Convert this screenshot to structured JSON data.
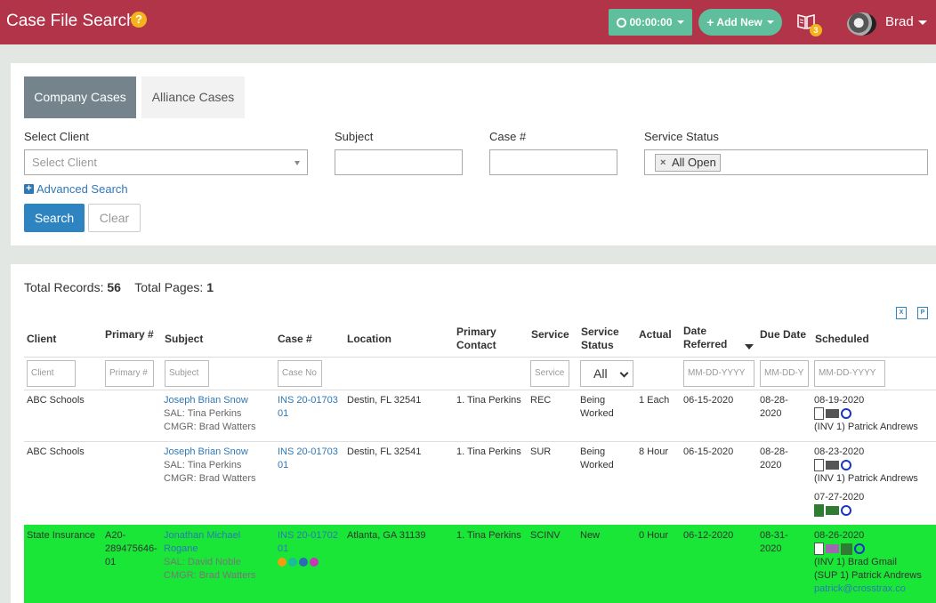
{
  "header": {
    "title": "Case File Search",
    "help": "?",
    "timer_label": "00:00:00",
    "add_new_label": "Add New",
    "notif_count": "3",
    "user_name": "Brad",
    "color": "#b13449"
  },
  "tabs": [
    {
      "label": "Company Cases",
      "active": true
    },
    {
      "label": "Alliance Cases",
      "active": false
    }
  ],
  "filters": {
    "client_label": "Select Client",
    "client_placeholder": "Select Client",
    "subject_label": "Subject",
    "subject_value": "",
    "case_label": "Case #",
    "case_value": "",
    "status_label": "Service Status",
    "status_tag": "All Open",
    "advanced": "Advanced Search",
    "search_btn": "Search",
    "clear_btn": "Clear"
  },
  "results": {
    "total_records_label": "Total Records:",
    "total_records": "56",
    "total_pages_label": "Total Pages:",
    "total_pages": "1"
  },
  "table": {
    "headers": {
      "client": "Client",
      "primary": "Primary #",
      "subject": "Subject",
      "case": "Case #",
      "location": "Location",
      "contact1": "Primary",
      "contact2": "Contact",
      "service": "Service",
      "status1": "Service",
      "status2": "Status",
      "actual": "Actual",
      "referred1": "Date",
      "referred2": "Referred",
      "due": "Due Date",
      "scheduled": "Scheduled"
    },
    "filter_placeholders": {
      "client": "Client",
      "primary": "Primary #",
      "subject": "Subject",
      "case": "Case No",
      "service": "Service",
      "status": "All",
      "referred": "MM-DD-YYYY",
      "due": "MM-DD-Y",
      "scheduled": "MM-DD-YYYY"
    },
    "rows": [
      {
        "client": "ABC Schools",
        "primary": "",
        "subject": "Joseph Brian Snow",
        "sal": "SAL: Tina Perkins",
        "cmgr": "CMGR: Brad Watters",
        "case1": "INS 20-01703",
        "case2": "01",
        "location": "Destin, FL 32541",
        "contact": "1. Tina Perkins",
        "service": "REC",
        "status1": "Being",
        "status2": "Worked",
        "actual": "1 Each",
        "referred": "06-15-2020",
        "due1": "08-28-",
        "due2": "2020",
        "sched_date": "08-19-2020",
        "sched_who": "(INV 1) Patrick Andrews"
      },
      {
        "client": "ABC Schools",
        "primary": "",
        "subject": "Joseph Brian Snow",
        "sal": "SAL: Tina Perkins",
        "cmgr": "CMGR: Brad Watters",
        "case1": "INS 20-01703",
        "case2": "01",
        "location": "Destin, FL 32541",
        "contact": "1. Tina Perkins",
        "service": "SUR",
        "status1": "Being",
        "status2": "Worked",
        "actual": "8 Hour",
        "referred": "06-15-2020",
        "due1": "08-28-",
        "due2": "2020",
        "sched_date": "08-23-2020",
        "sched_who": "(INV 1) Patrick Andrews",
        "sched_date2": "07-27-2020"
      },
      {
        "client": "State Insurance",
        "primary1": "A20-",
        "primary2": "289475646-",
        "primary3": "01",
        "subject1": "Jonathan Michael",
        "subject2": "Rogane",
        "sal": "SAL: David Noble",
        "cmgr": "CMGR: Brad Watters",
        "case1": "INS 20-01702",
        "case2": "01",
        "location": "Atlanta, GA 31139",
        "contact": "1. Tina Perkins",
        "service": "SCINV",
        "status1": "New",
        "actual": "0 Hour",
        "referred": "06-12-2020",
        "due1": "08-31-",
        "due2": "2020",
        "sched_date": "08-26-2020",
        "sched_who": "(INV 1) Brad Gmail",
        "sched_who2": "(SUP 1) Patrick Andrews",
        "sched_email": "patrick@crosstrax.co",
        "dots": [
          "#f39c12",
          "#1abc9c",
          "#2d6bb5",
          "#c539b4"
        ],
        "highlight": "#19e636"
      }
    ]
  }
}
